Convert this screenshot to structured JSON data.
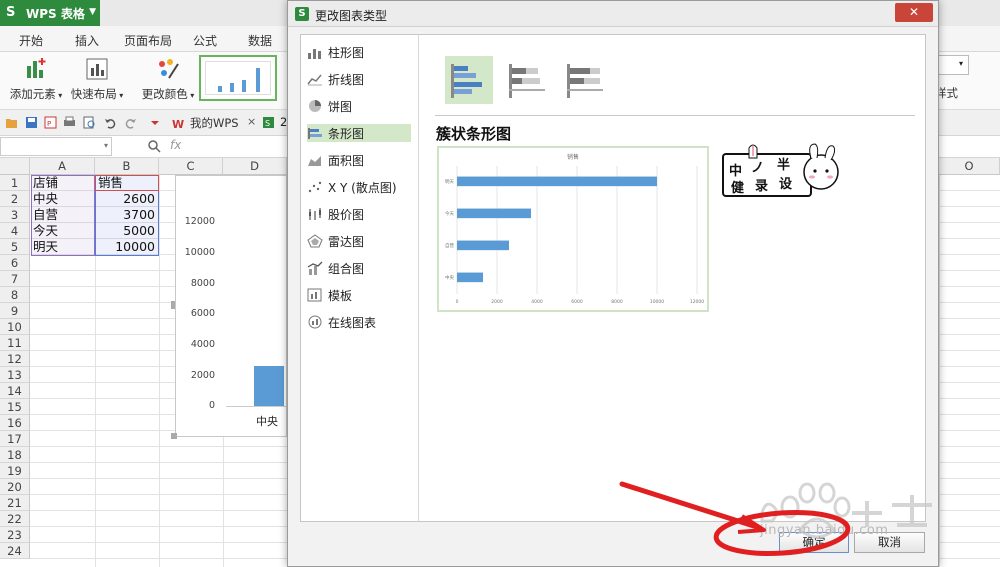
{
  "app": {
    "title": "WPS 表格"
  },
  "menu": [
    "开始",
    "插入",
    "页面布局",
    "公式",
    "数据"
  ],
  "ribbon": {
    "add_element": "添加元素",
    "quick_layout": "快速布局",
    "change_color": "更改颜色",
    "style_label": "样式"
  },
  "quickbar": {
    "wps_tab": "我的WPS",
    "close": "×",
    "tab_fragment": "2"
  },
  "formula": {
    "fx": "fx"
  },
  "sheet": {
    "columns": [
      "A",
      "B",
      "C",
      "D",
      "O"
    ],
    "rows": [
      "1",
      "2",
      "3",
      "4",
      "5",
      "6",
      "7",
      "8",
      "9",
      "10",
      "11",
      "12",
      "13",
      "14",
      "15",
      "16",
      "17",
      "18",
      "19",
      "20",
      "21",
      "22",
      "23",
      "24"
    ],
    "header": {
      "a": "店铺",
      "b": "销售"
    },
    "data": [
      {
        "store": "中央",
        "sales": "2600"
      },
      {
        "store": "自营",
        "sales": "3700"
      },
      {
        "store": "今天",
        "sales": "5000"
      },
      {
        "store": "明天",
        "sales": "10000"
      }
    ],
    "chart_ticks": [
      "12000",
      "10000",
      "8000",
      "6000",
      "4000",
      "2000",
      "0"
    ],
    "chart_category": "中央"
  },
  "dialog": {
    "title": "更改图表类型",
    "close": "✕",
    "types": [
      {
        "label": "柱形图",
        "icon": "column-chart-icon"
      },
      {
        "label": "折线图",
        "icon": "line-chart-icon"
      },
      {
        "label": "饼图",
        "icon": "pie-chart-icon"
      },
      {
        "label": "条形图",
        "icon": "bar-chart-icon"
      },
      {
        "label": "面积图",
        "icon": "area-chart-icon"
      },
      {
        "label": "X Y (散点图)",
        "icon": "scatter-chart-icon"
      },
      {
        "label": "股价图",
        "icon": "stock-chart-icon"
      },
      {
        "label": "雷达图",
        "icon": "radar-chart-icon"
      },
      {
        "label": "组合图",
        "icon": "combo-chart-icon"
      },
      {
        "label": "模板",
        "icon": "template-icon"
      },
      {
        "label": "在线图表",
        "icon": "online-chart-icon"
      }
    ],
    "selected_type_index": 3,
    "subtitle": "簇状条形图",
    "ok": "确定",
    "cancel": "取消"
  },
  "preview": {
    "title": "销售",
    "categories": [
      "明天",
      "今天",
      "自营",
      "中央"
    ],
    "values": [
      10000,
      3700,
      2600,
      1300
    ],
    "axis_ticks": [
      "0",
      "2000",
      "4000",
      "6000",
      "8000",
      "10000",
      "12000"
    ],
    "bar_color": "#5b9bd5"
  },
  "sticker": {
    "line1": "中 ノ 半",
    "line2": "健 录 设"
  },
  "watermark": {
    "text": "jingyan.baidu.com"
  },
  "colors": {
    "accent_green": "#2e8b3d",
    "selected_bg": "#d3e8c9",
    "arrow_red": "#e02020",
    "bar_blue": "#5b9bd5"
  }
}
